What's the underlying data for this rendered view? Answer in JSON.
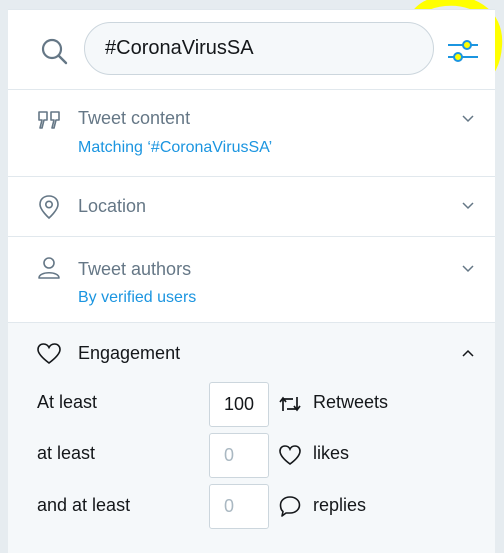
{
  "column": {
    "number": "4"
  },
  "search": {
    "query": "#CoronaVirusSA"
  },
  "sections": {
    "tweet_content": {
      "title": "Tweet content",
      "subtitle": "Matching ‘#CoronaVirusSA’"
    },
    "location": {
      "title": "Location"
    },
    "tweet_authors": {
      "title": "Tweet authors",
      "subtitle": "By verified users"
    },
    "engagement": {
      "title": "Engagement",
      "rows": [
        {
          "label": "At least",
          "value": "100",
          "suffix": "Retweets"
        },
        {
          "label": "at least",
          "placeholder": "0",
          "suffix": "likes"
        },
        {
          "label": "and at least",
          "placeholder": "0",
          "suffix": "replies"
        }
      ]
    }
  },
  "colors": {
    "accent": "#1b95e0",
    "highlight": "#ffff00"
  }
}
